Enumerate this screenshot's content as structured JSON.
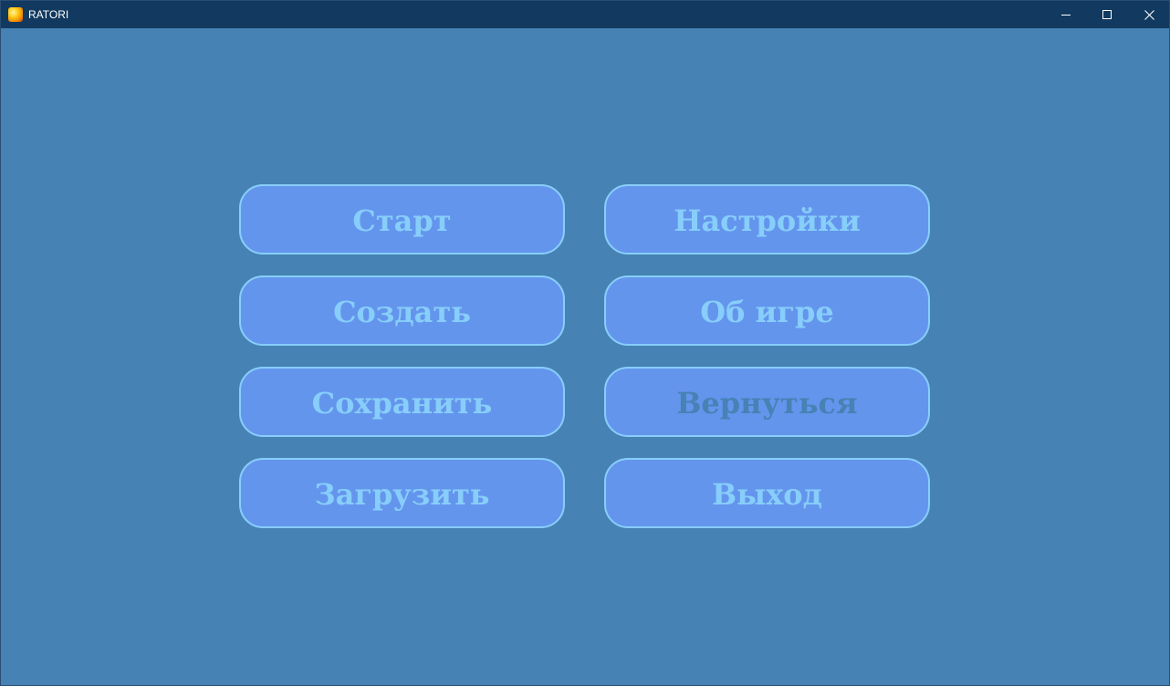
{
  "window": {
    "title": "RATORI",
    "icon": "app-logo-icon",
    "controls": {
      "minimize_icon": "minimize-icon",
      "maximize_icon": "maximize-icon",
      "close_icon": "close-icon"
    }
  },
  "colors": {
    "background": "#4682b4",
    "titlebar": "#123a60",
    "button_fill": "#6495ed",
    "button_border": "#87cefa",
    "button_text": "#87cefa",
    "button_text_disabled": "#4682b4"
  },
  "menu": {
    "start": "Старт",
    "settings": "Настройки",
    "create": "Создать",
    "about": "Об игре",
    "save": "Сохранить",
    "back": "Вернуться",
    "load": "Загрузить",
    "exit": "Выход"
  }
}
